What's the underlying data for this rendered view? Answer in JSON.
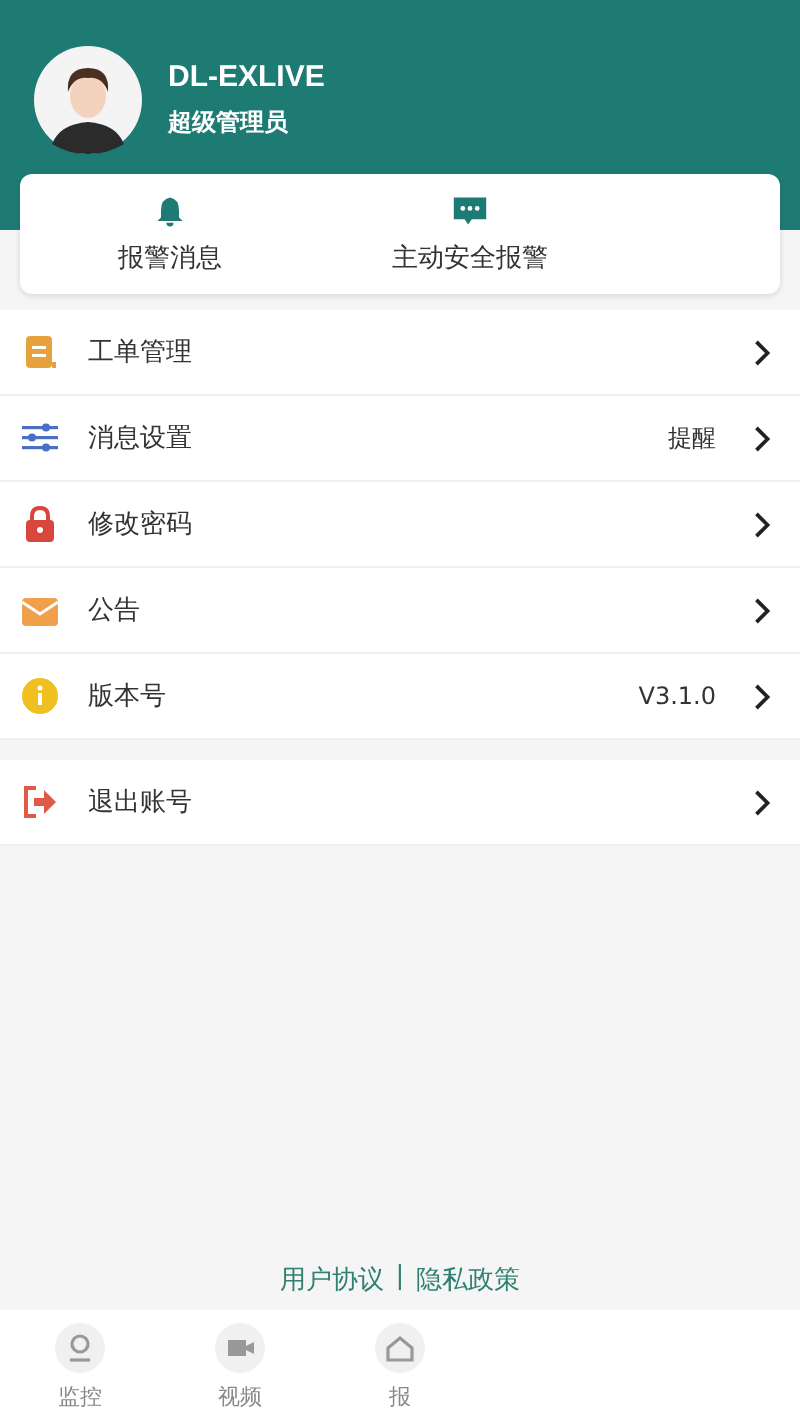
{
  "profile": {
    "name": "DL-EXLIVE",
    "role": "超级管理员"
  },
  "quick_actions": [
    {
      "kind": "bell",
      "label": "报警消息"
    },
    {
      "kind": "chat",
      "label": "主动安全报警"
    }
  ],
  "menu": [
    {
      "kind": "orders",
      "label": "工单管理"
    },
    {
      "kind": "sliders",
      "label": "消息设置",
      "value": "提醒"
    },
    {
      "kind": "lock",
      "label": "修改密码"
    },
    {
      "kind": "mail",
      "label": "公告"
    },
    {
      "kind": "info",
      "label": "版本号",
      "value": "V3.1.0"
    }
  ],
  "logout": {
    "label": "退出账号"
  },
  "footer_links": [
    "用户协议",
    "隐私政策"
  ],
  "footer_separator": "|",
  "tabs": [
    {
      "kind": "monitor",
      "label": "监控",
      "selected": false
    },
    {
      "kind": "video",
      "label": "视频",
      "selected": false
    },
    {
      "kind": "report",
      "label": "报",
      "selected": false
    }
  ]
}
